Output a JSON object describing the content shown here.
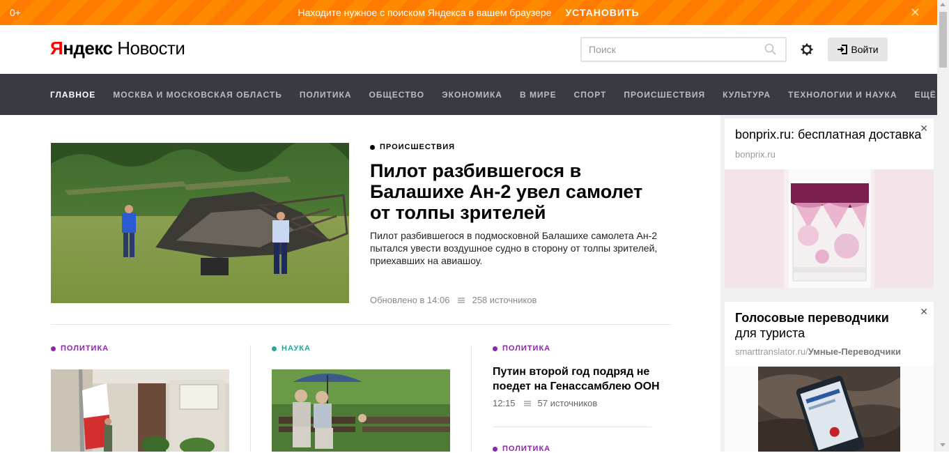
{
  "promo": {
    "age": "0+",
    "message": "Находите нужное с поиском Яндекса в вашем браузере",
    "install": "УСТАНОВИТЬ",
    "close": "✕"
  },
  "header": {
    "logo_ya": "Я",
    "logo_ndex": "ндекс",
    "logo_news": "Новости",
    "search_placeholder": "Поиск",
    "login": "Войти"
  },
  "nav": {
    "items": [
      "ГЛАВНОЕ",
      "МОСКВА И МОСКОВСКАЯ ОБЛАСТЬ",
      "ПОЛИТИКА",
      "ОБЩЕСТВО",
      "ЭКОНОМИКА",
      "В МИРЕ",
      "СПОРТ",
      "ПРОИСШЕСТВИЯ",
      "КУЛЬТУРА",
      "ТЕХНОЛОГИИ И НАУКА",
      "ЕЩЁ"
    ]
  },
  "main_story": {
    "category": "ПРОИСШЕСТВИЯ",
    "category_color": "#000000",
    "title": "Пилот разбившегося в Балашихе Ан-2 увел самолет от толпы зрителей",
    "description": "Пилот разбившегося в подмосковной Балашихе самолета Ан-2 пытался увести воздушное судно в сторону от толпы зрителей, приехавших на авиашоу.",
    "updated": "Обновлено в 14:06",
    "sources": "258 источников"
  },
  "stories": [
    {
      "category": "ПОЛИТИКА",
      "category_color": "#8e24aa"
    },
    {
      "category": "НАУКА",
      "category_color": "#26a69a"
    },
    {
      "category": "ПОЛИТИКА",
      "category_color": "#8e24aa",
      "title": "Путин второй год подряд не поедет на Генассамблею ООН",
      "time": "12:15",
      "sources": "57 источников"
    },
    {
      "category": "ПОЛИТИКА",
      "category_color": "#8e24aa"
    }
  ],
  "ads": [
    {
      "title": "bonprix.ru: бесплатная доставка",
      "domain": "bonprix.ru",
      "close": "✕"
    },
    {
      "title_bold": "Голосовые переводчики",
      "title_rest": "для туриста",
      "domain": "smarttranslator.ru/",
      "domain_bold": "Умные-Переводчики",
      "close": "✕"
    }
  ]
}
